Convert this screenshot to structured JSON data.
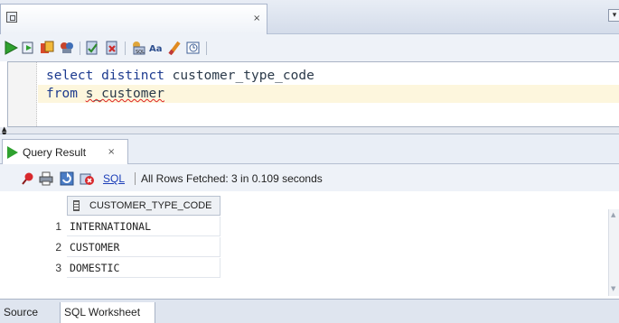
{
  "document_tab": {
    "close_glyph": "×"
  },
  "editor": {
    "line1": {
      "keyword": "select distinct",
      "rest": " customer_type_code"
    },
    "line2": {
      "keyword": "from",
      "space": " ",
      "table": "s_customer"
    }
  },
  "result_tab": {
    "label": "Query Result",
    "close_glyph": "×"
  },
  "result_toolbar": {
    "sql_link": "SQL",
    "status": "All Rows Fetched: 3 in 0.109 seconds"
  },
  "grid": {
    "column": "CUSTOMER_TYPE_CODE",
    "rows": [
      {
        "num": "1",
        "value": "INTERNATIONAL"
      },
      {
        "num": "2",
        "value": "CUSTOMER"
      },
      {
        "num": "3",
        "value": "DOMESTIC"
      }
    ]
  },
  "bottom_tabs": [
    {
      "label": "Source"
    },
    {
      "label": "SQL Worksheet"
    }
  ],
  "colors": {
    "accent_blue": "#1a3db8",
    "run_green": "#2fa12f",
    "current_line": "#fdf6dd"
  },
  "icons": [
    "worksheet-icon",
    "run-statement-icon",
    "run-script-icon",
    "autotrace-icon",
    "explain-plan-icon",
    "commit-icon",
    "rollback-icon",
    "sql-tuning-advisor-icon",
    "to-upper-lower-icon",
    "clear-icon",
    "history-icon",
    "pin-icon",
    "print-icon",
    "refresh-icon",
    "cancel-icon"
  ]
}
